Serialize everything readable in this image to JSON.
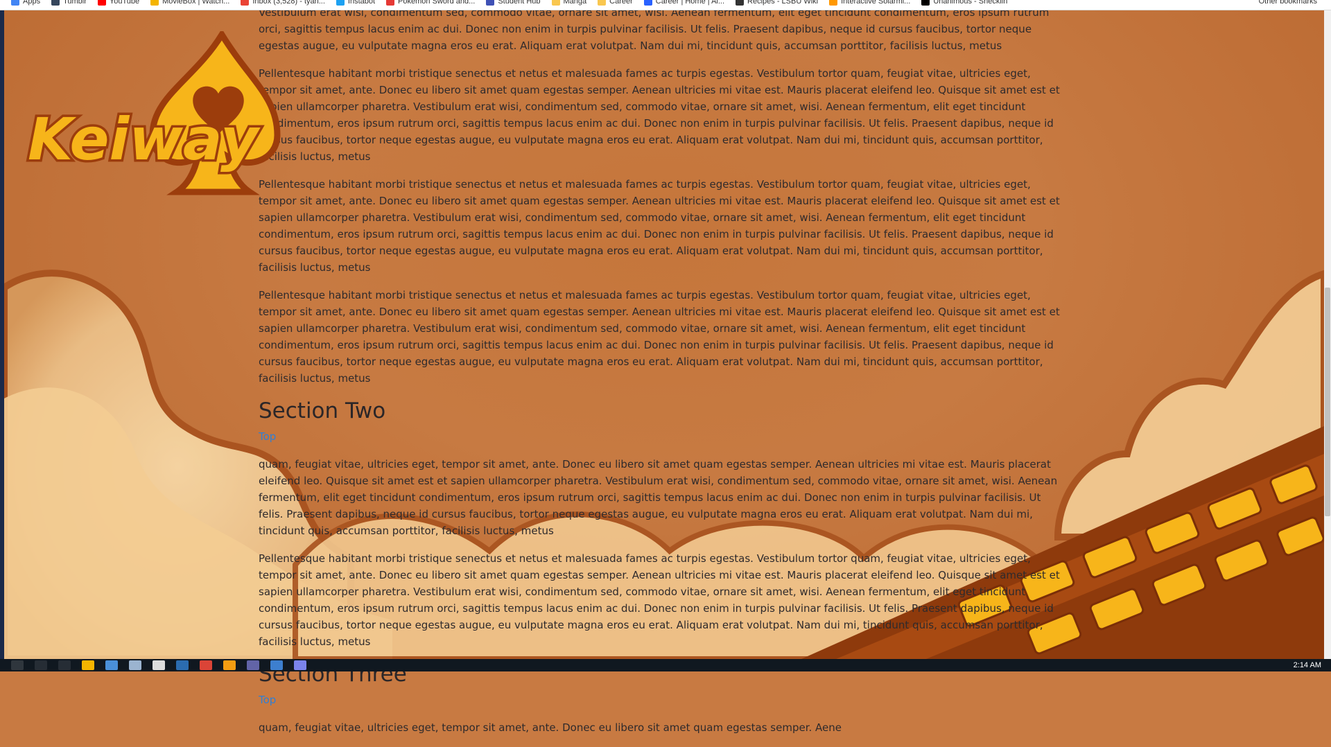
{
  "bookmarks": [
    {
      "label": "Apps",
      "color": "#4285f4"
    },
    {
      "label": "Tumblr",
      "color": "#35465c"
    },
    {
      "label": "YouTube",
      "color": "#ff0000"
    },
    {
      "label": "MovieBox | Watch...",
      "color": "#f4b400"
    },
    {
      "label": "Inbox (3,528) - tyah...",
      "color": "#ea4335"
    },
    {
      "label": "Instabot",
      "color": "#1da1f2"
    },
    {
      "label": "Pokémon Sword and...",
      "color": "#e53935"
    },
    {
      "label": "Student Hub",
      "color": "#3f51b5"
    },
    {
      "label": "Manga",
      "color": "#f9c74f"
    },
    {
      "label": "Career",
      "color": "#f9c74f"
    },
    {
      "label": "Career | Home | Al...",
      "color": "#2962ff"
    },
    {
      "label": "Recipes - LSBU Wiki",
      "color": "#333333"
    },
    {
      "label": "Interactive Solarmi...",
      "color": "#ff9800"
    },
    {
      "label": "Unanimous - Shecklin",
      "color": "#000000"
    }
  ],
  "bookmarks_other": "Other bookmarks",
  "logo": {
    "text": "Keiway"
  },
  "content": {
    "partial_top": "Vestibulum erat wisi, condimentum sed, commodo vitae, ornare sit amet, wisi. Aenean fermentum, elit eget tincidunt condimentum, eros ipsum rutrum orci, sagittis tempus lacus enim ac dui. Donec non enim in turpis pulvinar facilisis. Ut felis. Praesent dapibus, neque id cursus faucibus, tortor neque egestas augue, eu vulputate magna eros eu erat. Aliquam erat volutpat. Nam dui mi, tincidunt quis, accumsan porttitor, facilisis luctus, metus",
    "section1_paragraphs": [
      "Pellentesque habitant morbi tristique senectus et netus et malesuada fames ac turpis egestas. Vestibulum tortor quam, feugiat vitae, ultricies eget, tempor sit amet, ante. Donec eu libero sit amet quam egestas semper. Aenean ultricies mi vitae est. Mauris placerat eleifend leo. Quisque sit amet est et sapien ullamcorper pharetra. Vestibulum erat wisi, condimentum sed, commodo vitae, ornare sit amet, wisi. Aenean fermentum, elit eget tincidunt condimentum, eros ipsum rutrum orci, sagittis tempus lacus enim ac dui. Donec non enim in turpis pulvinar facilisis. Ut felis. Praesent dapibus, neque id cursus faucibus, tortor neque egestas augue, eu vulputate magna eros eu erat. Aliquam erat volutpat. Nam dui mi, tincidunt quis, accumsan porttitor, facilisis luctus, metus",
      "Pellentesque habitant morbi tristique senectus et netus et malesuada fames ac turpis egestas. Vestibulum tortor quam, feugiat vitae, ultricies eget, tempor sit amet, ante. Donec eu libero sit amet quam egestas semper. Aenean ultricies mi vitae est. Mauris placerat eleifend leo. Quisque sit amet est et sapien ullamcorper pharetra. Vestibulum erat wisi, condimentum sed, commodo vitae, ornare sit amet, wisi. Aenean fermentum, elit eget tincidunt condimentum, eros ipsum rutrum orci, sagittis tempus lacus enim ac dui. Donec non enim in turpis pulvinar facilisis. Ut felis. Praesent dapibus, neque id cursus faucibus, tortor neque egestas augue, eu vulputate magna eros eu erat. Aliquam erat volutpat. Nam dui mi, tincidunt quis, accumsan porttitor, facilisis luctus, metus",
      "Pellentesque habitant morbi tristique senectus et netus et malesuada fames ac turpis egestas. Vestibulum tortor quam, feugiat vitae, ultricies eget, tempor sit amet, ante. Donec eu libero sit amet quam egestas semper. Aenean ultricies mi vitae est. Mauris placerat eleifend leo. Quisque sit amet est et sapien ullamcorper pharetra. Vestibulum erat wisi, condimentum sed, commodo vitae, ornare sit amet, wisi. Aenean fermentum, elit eget tincidunt condimentum, eros ipsum rutrum orci, sagittis tempus lacus enim ac dui. Donec non enim in turpis pulvinar facilisis. Ut felis. Praesent dapibus, neque id cursus faucibus, tortor neque egestas augue, eu vulputate magna eros eu erat. Aliquam erat volutpat. Nam dui mi, tincidunt quis, accumsan porttitor, facilisis luctus, metus"
    ],
    "section2": {
      "title": "Section Two",
      "top_link": "Top",
      "p1": "quam, feugiat vitae, ultricies eget, tempor sit amet, ante. Donec eu libero sit amet quam egestas semper. Aenean ultricies mi vitae est. Mauris placerat eleifend leo. Quisque sit amet est et sapien ullamcorper pharetra. Vestibulum erat wisi, condimentum sed, commodo vitae, ornare sit amet, wisi. Aenean fermentum, elit eget tincidunt condimentum, eros ipsum rutrum orci, sagittis tempus lacus enim ac dui. Donec non enim in turpis pulvinar facilisis. Ut felis. Praesent dapibus, neque id cursus faucibus, tortor neque egestas augue, eu vulputate magna eros eu erat. Aliquam erat volutpat. Nam dui mi, tincidunt quis, accumsan porttitor, facilisis luctus, metus",
      "p2": "Pellentesque habitant morbi tristique senectus et netus et malesuada fames ac turpis egestas. Vestibulum tortor quam, feugiat vitae, ultricies eget, tempor sit amet, ante. Donec eu libero sit amet quam egestas semper. Aenean ultricies mi vitae est. Mauris placerat eleifend leo. Quisque sit amet est et sapien ullamcorper pharetra. Vestibulum erat wisi, condimentum sed, commodo vitae, ornare sit amet, wisi. Aenean fermentum, elit eget tincidunt condimentum, eros ipsum rutrum orci, sagittis tempus lacus enim ac dui. Donec non enim in turpis pulvinar facilisis. Ut felis. Praesent dapibus, neque id cursus faucibus, tortor neque egestas augue, eu vulputate magna eros eu erat. Aliquam erat volutpat. Nam dui mi, tincidunt quis, accumsan porttitor, facilisis luctus, metus"
    },
    "section3": {
      "title": "Section Three",
      "top_link": "Top",
      "p1": "quam, feugiat vitae, ultricies eget, tempor sit amet, ante. Donec eu libero sit amet quam egestas semper. Aene"
    }
  },
  "taskbar": {
    "clock": "2:14 AM"
  },
  "colors": {
    "background": "#c87a42",
    "text": "#2e2a2c",
    "link": "#2f7fd6",
    "logo_gold": "#f7b51a",
    "logo_brown": "#9c3d0c"
  }
}
